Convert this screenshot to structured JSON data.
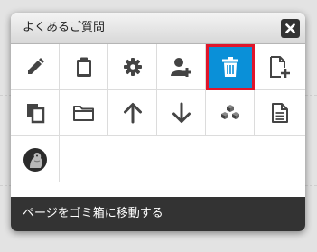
{
  "dialog": {
    "title": "よくあるご質問",
    "status_text": "ページをゴミ箱に移動する",
    "accent_color": "#0a90d8",
    "highlight_color": "#e0162b"
  },
  "toolbar": {
    "rows": [
      [
        "pencil-icon",
        "clipboard-icon",
        "gear-icon",
        "add-user-icon",
        "trash-icon",
        "add-page-icon"
      ],
      [
        "copy-icon",
        "folder-icon",
        "arrow-up-icon",
        "arrow-down-icon",
        "cubes-icon",
        "document-icon"
      ],
      [
        "avatar-icon"
      ]
    ],
    "active_icon": "trash-icon"
  }
}
